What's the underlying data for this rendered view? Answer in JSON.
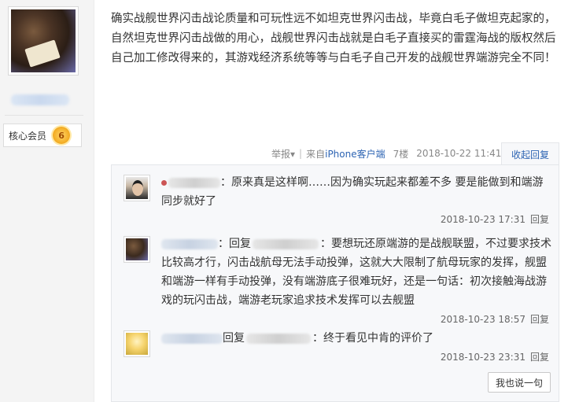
{
  "sidebar": {
    "member_label": "核心会员",
    "level": "6"
  },
  "post": {
    "content": "确实战舰世界闪击战论质量和可玩性远不如坦克世界闪击战，毕竟白毛子做坦克起家的，自然坦克世界闪击战做的用心，战舰世界闪击战就是白毛子直接买的雷霆海战的版权然后自己加工修改得来的，其游戏经济系统等等与白毛子自己开发的战舰世界端游完全不同！",
    "report_label": "举报",
    "report_arrow": "▾",
    "source_prefix": "来自",
    "source_link": "iPhone客户端",
    "floor": "7楼",
    "timestamp": "2018-10-22 11:41",
    "fold_label": "收起回复"
  },
  "replies": [
    {
      "text": "原来真是这样啊……因为确实玩起来都差不多 要是能做到和端游同步就好了",
      "time": "2018-10-23 17:31",
      "action": "回复"
    },
    {
      "reply_word": "回复",
      "text": "要想玩还原端游的是战舰联盟，不过要求技术比较高才行，闪击战航母无法手动投弹，这就大大限制了航母玩家的发挥，舰盟和端游一样有手动投弹，没有端游底子很难玩好，还是一句话：初次接触海战游戏的玩闪击战，端游老玩家追求技术发挥可以去舰盟",
      "time": "2018-10-23 18:57",
      "action": "回复"
    },
    {
      "reply_word": "回复",
      "text": "终于看见中肯的评价了",
      "time": "2018-10-23 23:31",
      "action": "回复"
    }
  ],
  "say_button": "我也说一句"
}
